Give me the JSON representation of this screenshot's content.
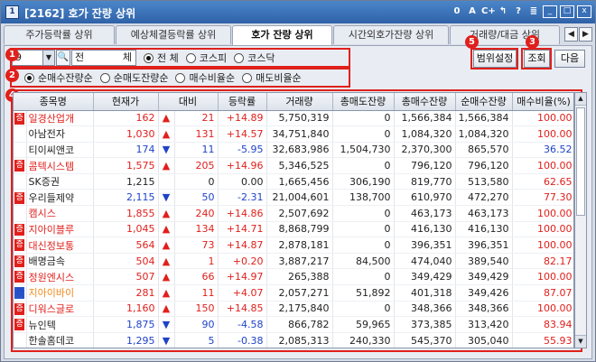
{
  "window": {
    "sys_icon": "1",
    "title": "[2162] 호가 잔량 상위",
    "tools": [
      "0",
      "A",
      "C+",
      "↰",
      "?",
      "≣"
    ],
    "minimize": "_",
    "restore": "□",
    "close": "x"
  },
  "tabs": [
    {
      "label": "주가등락률 상위",
      "active": false
    },
    {
      "label": "예상체결등락률 상위",
      "active": false
    },
    {
      "label": "호가 잔량 상위",
      "active": true
    },
    {
      "label": "시간외호가잔량 상위",
      "active": false
    },
    {
      "label": "거래량/대금 상위",
      "active": false
    }
  ],
  "tab_prev": "◀",
  "tab_next": "▶",
  "filters": {
    "code_value": "9",
    "name_value_left": "전",
    "name_value_right": "체",
    "market_options": [
      {
        "label": "전 체",
        "selected": true
      },
      {
        "label": "코스피",
        "selected": false
      },
      {
        "label": "코스닥",
        "selected": false
      }
    ],
    "sort_options": [
      {
        "label": "순매수잔량순",
        "selected": true
      },
      {
        "label": "순매도잔량순",
        "selected": false
      },
      {
        "label": "매수비율순",
        "selected": false
      },
      {
        "label": "매도비율순",
        "selected": false
      }
    ]
  },
  "buttons": {
    "range_settings": "범위설정",
    "query": "조회",
    "next": "다음"
  },
  "badges": {
    "b1": "1",
    "b2": "2",
    "b3": "3",
    "b4": "4",
    "b5": "5"
  },
  "table": {
    "headers": [
      "종목명",
      "현재가",
      "대비",
      "등락률",
      "거래량",
      "총매도잔량",
      "총매수잔량",
      "순매수잔량",
      "매수비율(%)"
    ],
    "rows": [
      {
        "flag": "증",
        "name": "일경산업개",
        "name_color": "red",
        "price": "162",
        "dir": "up",
        "change": "21",
        "rate": "+14.89",
        "volume": "5,750,319",
        "sell": "0",
        "buy": "1,566,384",
        "net": "1,566,384",
        "ratio": "100.00"
      },
      {
        "flag": "",
        "name": "아남전자",
        "name_color": "black",
        "price": "1,030",
        "dir": "up",
        "change": "131",
        "rate": "+14.57",
        "volume": "34,751,840",
        "sell": "0",
        "buy": "1,084,320",
        "net": "1,084,320",
        "ratio": "100.00"
      },
      {
        "flag": "",
        "name": "티이씨앤코",
        "name_color": "black",
        "price": "174",
        "dir": "down",
        "change": "11",
        "rate": "-5.95",
        "volume": "32,683,986",
        "sell": "1,504,730",
        "buy": "2,370,300",
        "net": "865,570",
        "ratio": "36.52"
      },
      {
        "flag": "증",
        "name": "콤텍시스템",
        "name_color": "red",
        "price": "1,575",
        "dir": "up",
        "change": "205",
        "rate": "+14.96",
        "volume": "5,346,525",
        "sell": "0",
        "buy": "796,120",
        "net": "796,120",
        "ratio": "100.00"
      },
      {
        "flag": "",
        "name": "SK증권",
        "name_color": "black",
        "price": "1,215",
        "dir": "none",
        "change": "0",
        "rate": "0.00",
        "volume": "1,665,456",
        "sell": "306,190",
        "buy": "819,770",
        "net": "513,580",
        "ratio": "62.65"
      },
      {
        "flag": "증",
        "name": "우리들제약",
        "name_color": "black",
        "price": "2,115",
        "dir": "down",
        "change": "50",
        "rate": "-2.31",
        "volume": "21,004,601",
        "sell": "138,700",
        "buy": "610,970",
        "net": "472,270",
        "ratio": "77.30"
      },
      {
        "flag": "",
        "name": "캠시스",
        "name_color": "red",
        "price": "1,855",
        "dir": "up",
        "change": "240",
        "rate": "+14.86",
        "volume": "2,507,692",
        "sell": "0",
        "buy": "463,173",
        "net": "463,173",
        "ratio": "100.00"
      },
      {
        "flag": "증",
        "name": "지아이블루",
        "name_color": "red",
        "price": "1,045",
        "dir": "up",
        "change": "134",
        "rate": "+14.71",
        "volume": "8,868,799",
        "sell": "0",
        "buy": "416,130",
        "net": "416,130",
        "ratio": "100.00"
      },
      {
        "flag": "증",
        "name": "대신정보통",
        "name_color": "red",
        "price": "564",
        "dir": "up",
        "change": "73",
        "rate": "+14.87",
        "volume": "2,878,181",
        "sell": "0",
        "buy": "396,351",
        "net": "396,351",
        "ratio": "100.00"
      },
      {
        "flag": "증",
        "name": "배명금속",
        "name_color": "black",
        "price": "504",
        "dir": "up",
        "change": "1",
        "rate": "+0.20",
        "volume": "3,887,217",
        "sell": "84,500",
        "buy": "474,040",
        "net": "389,540",
        "ratio": "82.17"
      },
      {
        "flag": "증",
        "name": "정원엔시스",
        "name_color": "red",
        "price": "507",
        "dir": "up",
        "change": "66",
        "rate": "+14.97",
        "volume": "265,388",
        "sell": "0",
        "buy": "349,429",
        "net": "349,429",
        "ratio": "100.00"
      },
      {
        "flag": "관",
        "name": "지아이바이",
        "name_color": "orange",
        "price": "281",
        "dir": "up",
        "change": "11",
        "rate": "+4.07",
        "volume": "2,057,271",
        "sell": "51,892",
        "buy": "401,318",
        "net": "349,426",
        "ratio": "87.07"
      },
      {
        "flag": "증",
        "name": "디워스글로",
        "name_color": "red",
        "price": "1,160",
        "dir": "up",
        "change": "150",
        "rate": "+14.85",
        "volume": "2,175,840",
        "sell": "0",
        "buy": "348,366",
        "net": "348,366",
        "ratio": "100.00"
      },
      {
        "flag": "증",
        "name": "뉴인텍",
        "name_color": "black",
        "price": "1,875",
        "dir": "down",
        "change": "90",
        "rate": "-4.58",
        "volume": "866,782",
        "sell": "59,965",
        "buy": "373,385",
        "net": "313,420",
        "ratio": "83.94"
      },
      {
        "flag": "",
        "name": "한솔홈데코",
        "name_color": "black",
        "price": "1,295",
        "dir": "down",
        "change": "5",
        "rate": "-0.38",
        "volume": "2,085,313",
        "sell": "240,330",
        "buy": "545,370",
        "net": "305,040",
        "ratio": "55.93"
      }
    ]
  },
  "scrollbar": {
    "up": "▲",
    "down": "▼"
  },
  "colors": {
    "up": "#e0201c",
    "down": "#1f43c7",
    "neutral": "#222222",
    "orange": "#f08a1a",
    "highlight": "#e0201c",
    "title_bar": "#2f62a8"
  }
}
